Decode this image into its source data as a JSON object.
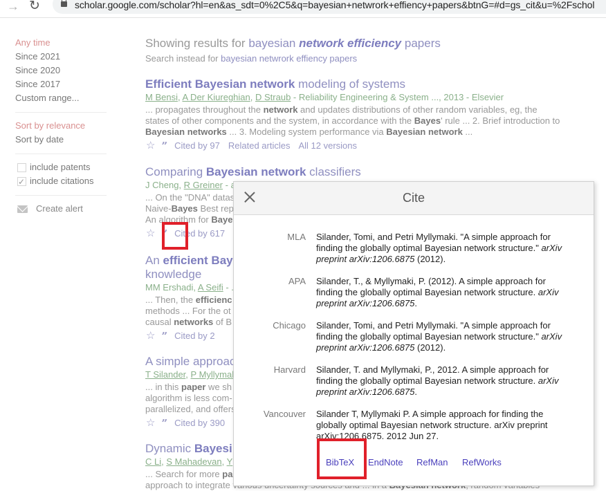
{
  "browser": {
    "url": "scholar.google.com/scholar?hl=en&as_sdt=0%2C5&q=bayesian+netwrork+effiency+papers&btnG=#d=gs_cit&u=%2Fschol"
  },
  "sidebar": {
    "time_filters": [
      {
        "label": "Any time",
        "selected": true
      },
      {
        "label": "Since 2021",
        "selected": false
      },
      {
        "label": "Since 2020",
        "selected": false
      },
      {
        "label": "Since 2017",
        "selected": false
      },
      {
        "label": "Custom range...",
        "selected": false
      }
    ],
    "sort_options": [
      {
        "label": "Sort by relevance",
        "selected": true
      },
      {
        "label": "Sort by date",
        "selected": false
      }
    ],
    "include_patents": {
      "label": "include patents",
      "checked": false
    },
    "include_citations": {
      "label": "include citations",
      "checked": true
    },
    "create_alert": "Create alert"
  },
  "correction": {
    "prefix": "Showing results for",
    "query_plain_1": "bayesian",
    "query_bold": "network efficiency",
    "query_plain_2": "papers",
    "instead_prefix": "Search instead for",
    "instead_query": "bayesian netwrork effiency papers"
  },
  "results": [
    {
      "title_bold": "Efficient Bayesian network",
      "title_rest": " modeling of systems",
      "authors": [
        "M Bensi",
        "A Der Kiureghian",
        "D Straub"
      ],
      "source": " - Reliability Engineering & System ..., 2013 - Elsevier",
      "snippet_parts": [
        {
          "t": "... propagates throughout the "
        },
        {
          "b": "network"
        },
        {
          "t": " and updates distributions of other random variables, eg, the states of other components and the system, in accordance with the "
        },
        {
          "b": "Bayes"
        },
        {
          "t": "' rule ... 2. Brief introduction to "
        },
        {
          "b": "Bayesian networks"
        },
        {
          "t": " ... 3. Modeling system performance via "
        },
        {
          "b": "Bayesian network"
        },
        {
          "t": " ..."
        }
      ],
      "cited_by": "Cited by 97",
      "related": "Related articles",
      "versions": "All 12 versions"
    },
    {
      "title_pre": "Comparing ",
      "title_bold": "Bayesian network",
      "title_rest": " classifiers",
      "author_plain": "J Cheng, ",
      "authors": [
        "R Greiner"
      ],
      "source": " - a",
      "snippet_parts": [
        {
          "t": "... On the \"DNA\" datas"
        }
      ],
      "snippet_line2_pre": "Naive-",
      "snippet_line2_bold": "Bayes",
      "snippet_line2_rest": " Best rep",
      "snippet_line3_pre": "An algorithm for ",
      "snippet_line3_bold": "Baye",
      "cited_by": "Cited by 617"
    },
    {
      "title_pre": "An ",
      "title_bold": "efficient Bay",
      "title_line2": "knowledge",
      "author_plain": "MM Ershadi, ",
      "authors": [
        "A Seifi"
      ],
      "source": " - .",
      "snippet_l1_pre": "... Then, the ",
      "snippet_l1_bold": "efficienc",
      "snippet_l2": "methods ... For the ot",
      "snippet_l3_pre": "causal ",
      "snippet_l3_bold": "networks",
      "snippet_l3_rest": " of B",
      "cited_by": "Cited by 2"
    },
    {
      "title": "A simple approac",
      "authors": [
        "T Silander",
        "P Myllymal"
      ],
      "snippet_l1_pre": "... in this ",
      "snippet_l1_bold": "paper",
      "snippet_l1_rest": " we sh",
      "snippet_l2": "algorithm is less com-",
      "snippet_l3": "parallelized, and offers",
      "cited_by": "Cited by 390"
    },
    {
      "title_pre": "Dynamic ",
      "title_bold": "Bayesi",
      "authors": [
        "C Li",
        "S Mahadevan",
        "Y"
      ],
      "snippet_l1_pre": "... Search for more ",
      "snippet_l1_bold": "pa",
      "snippet_l2_pre": "approach to integrate various uncertainty sources and ... in a ",
      "snippet_l2_bold": "Bayesian network",
      "snippet_l2_rest": ", random variables"
    }
  ],
  "cite_dialog": {
    "title": "Cite",
    "citations": [
      {
        "style": "MLA",
        "text_parts": [
          {
            "t": "Silander, Tomi, and Petri Myllymaki. \"A simple approach for finding the globally optimal Bayesian network structure.\" "
          },
          {
            "i": "arXiv preprint arXiv:1206.6875"
          },
          {
            "t": " (2012)."
          }
        ]
      },
      {
        "style": "APA",
        "text_parts": [
          {
            "t": "Silander, T., & Myllymaki, P. (2012). A simple approach for finding the globally optimal Bayesian network structure. "
          },
          {
            "i": "arXiv preprint arXiv:1206.6875"
          },
          {
            "t": "."
          }
        ]
      },
      {
        "style": "Chicago",
        "text_parts": [
          {
            "t": "Silander, Tomi, and Petri Myllymaki. \"A simple approach for finding the globally optimal Bayesian network structure.\" "
          },
          {
            "i": "arXiv preprint arXiv:1206.6875"
          },
          {
            "t": " (2012)."
          }
        ]
      },
      {
        "style": "Harvard",
        "text_parts": [
          {
            "t": "Silander, T. and Myllymaki, P., 2012. A simple approach for finding the globally optimal Bayesian network structure. "
          },
          {
            "i": "arXiv preprint arXiv:1206.6875"
          },
          {
            "t": "."
          }
        ]
      },
      {
        "style": "Vancouver",
        "text_parts": [
          {
            "t": "Silander T, Myllymaki P. A simple approach for finding the globally optimal Bayesian network structure. arXiv preprint arXiv:1206.6875. 2012 Jun 27."
          }
        ]
      }
    ],
    "export_links": [
      "BibTeX",
      "EndNote",
      "RefMan",
      "RefWorks"
    ]
  },
  "annotations": {
    "highlight_color": "#e0202a"
  }
}
